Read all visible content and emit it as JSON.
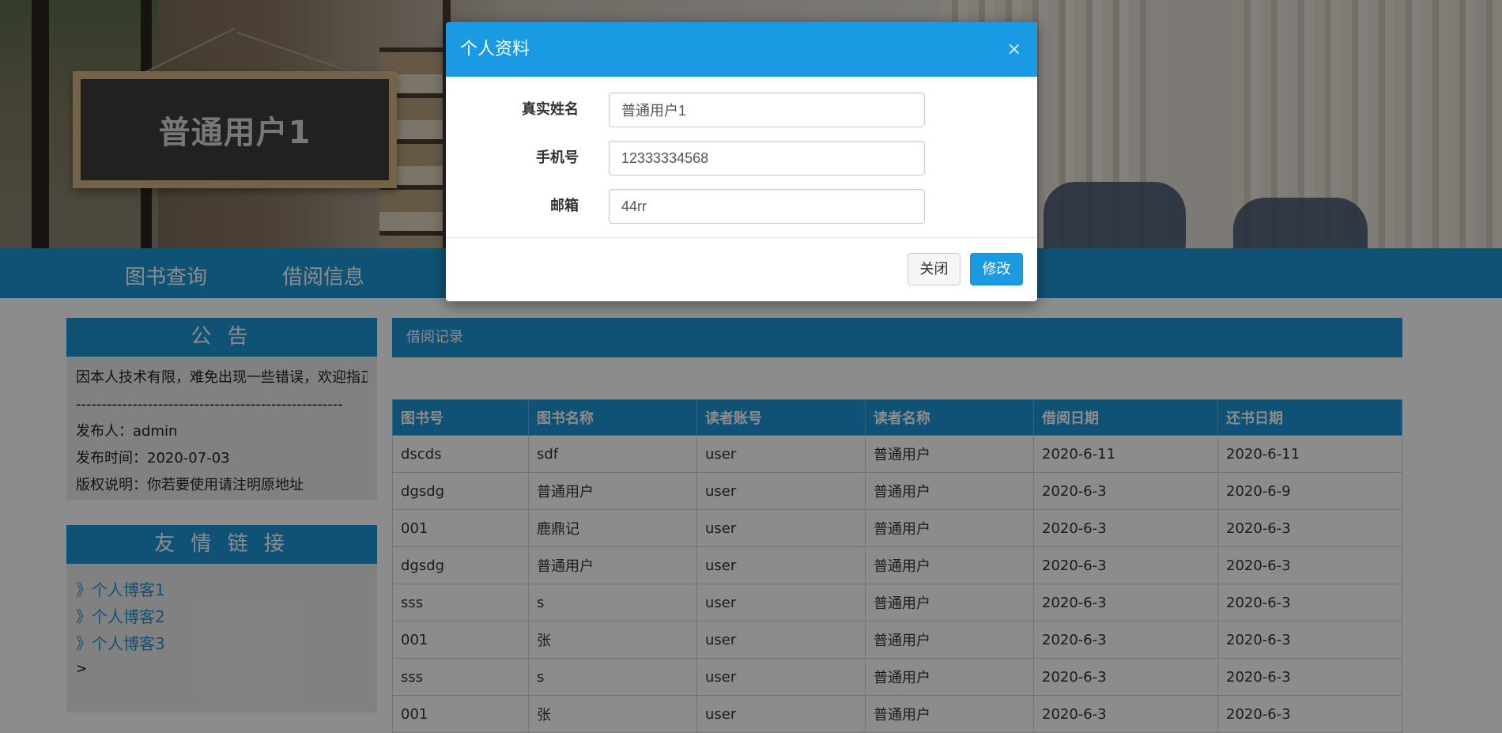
{
  "banner": {
    "sign_text": "普通用户1"
  },
  "nav": {
    "items": [
      "图书查询",
      "借阅信息"
    ]
  },
  "sidebar": {
    "notice": {
      "title": "公 告",
      "lines": [
        "因本人技术有限，难免出现一些错误，欢迎指正",
        "----------------------------------------------------",
        "发布人：admin",
        "发布时间：2020-07-03",
        "版权说明：你若要使用请注明原地址"
      ]
    },
    "links": {
      "title": "友 情 链 接",
      "items": [
        "》个人博客1",
        "》个人博客2",
        "》个人博客3"
      ],
      "trailing": ">"
    }
  },
  "main": {
    "title": "借阅记录",
    "columns": [
      "图书号",
      "图书名称",
      "读者账号",
      "读者名称",
      "借阅日期",
      "还书日期"
    ],
    "rows": [
      [
        "dscds",
        "sdf",
        "user",
        "普通用户",
        "2020-6-11",
        "2020-6-11"
      ],
      [
        "dgsdg",
        "普通用户",
        "user",
        "普通用户",
        "2020-6-3",
        "2020-6-9"
      ],
      [
        "001",
        "鹿鼎记",
        "user",
        "普通用户",
        "2020-6-3",
        "2020-6-3"
      ],
      [
        "dgsdg",
        "普通用户",
        "user",
        "普通用户",
        "2020-6-3",
        "2020-6-3"
      ],
      [
        "sss",
        "s",
        "user",
        "普通用户",
        "2020-6-3",
        "2020-6-3"
      ],
      [
        "001",
        "张",
        "user",
        "普通用户",
        "2020-6-3",
        "2020-6-3"
      ],
      [
        "sss",
        "s",
        "user",
        "普通用户",
        "2020-6-3",
        "2020-6-3"
      ],
      [
        "001",
        "张",
        "user",
        "普通用户",
        "2020-6-3",
        "2020-6-3"
      ]
    ]
  },
  "modal": {
    "title": "个人资料",
    "close_glyph": "×",
    "fields": [
      {
        "label": "真实姓名",
        "value": "普通用户1"
      },
      {
        "label": "手机号",
        "value": "12333334568"
      },
      {
        "label": "邮箱",
        "value": "44rr"
      }
    ],
    "close_label": "关闭",
    "save_label": "修改"
  },
  "colors": {
    "primary": "#1e96d6",
    "modal_header": "#1b9ae4",
    "overlay": "rgba(0,0,0,0.45)"
  }
}
